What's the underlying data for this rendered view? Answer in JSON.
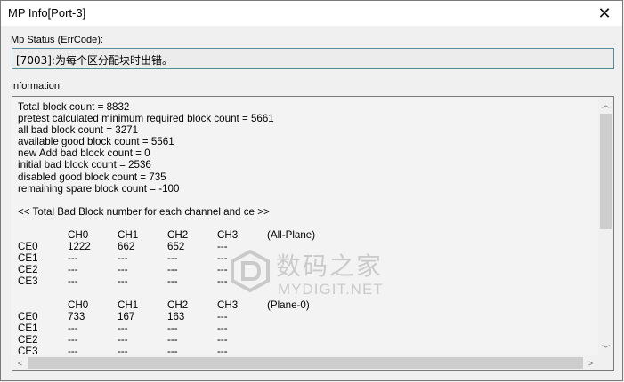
{
  "window": {
    "title": "MP Info[Port-3]",
    "close_glyph": "✕"
  },
  "mp_status": {
    "label": "Mp Status (ErrCode):",
    "value": "[7003]:为每个区分配块时出错。"
  },
  "information": {
    "label": "Information:",
    "summary_lines": [
      "Total block count = 8832",
      "pretest calculated minimum required block count = 5661",
      "all bad block count = 3271",
      "available good block count = 5561",
      "new Add bad block count = 0",
      "initial bad block count = 2536",
      "disabled good block count = 735",
      "remaining spare block count = -100"
    ],
    "section_heading": "<< Total Bad Block number for each channel and ce >>",
    "tables": [
      {
        "header": [
          "",
          "CH0",
          "CH1",
          "CH2",
          "CH3",
          "(All-Plane)"
        ],
        "rows": [
          [
            "CE0",
            "1222",
            "662",
            "652",
            "---"
          ],
          [
            "CE1",
            "---",
            "---",
            "---",
            "---"
          ],
          [
            "CE2",
            "---",
            "---",
            "---",
            "---"
          ],
          [
            "CE3",
            "---",
            "---",
            "---",
            "---"
          ]
        ]
      },
      {
        "header": [
          "",
          "CH0",
          "CH1",
          "CH2",
          "CH3",
          "(Plane-0)"
        ],
        "rows": [
          [
            "CE0",
            "733",
            "167",
            "163",
            "---"
          ],
          [
            "CE1",
            "---",
            "---",
            "---",
            "---"
          ],
          [
            "CE2",
            "---",
            "---",
            "---",
            "---"
          ],
          [
            "CE3",
            "---",
            "---",
            "---",
            "---"
          ]
        ]
      }
    ]
  },
  "scrollbar": {
    "up": "︿",
    "down": "﹀",
    "left": "<",
    "right": ">"
  },
  "watermark": {
    "cn": "数码之家",
    "en": "MYDIGIT.NET"
  }
}
